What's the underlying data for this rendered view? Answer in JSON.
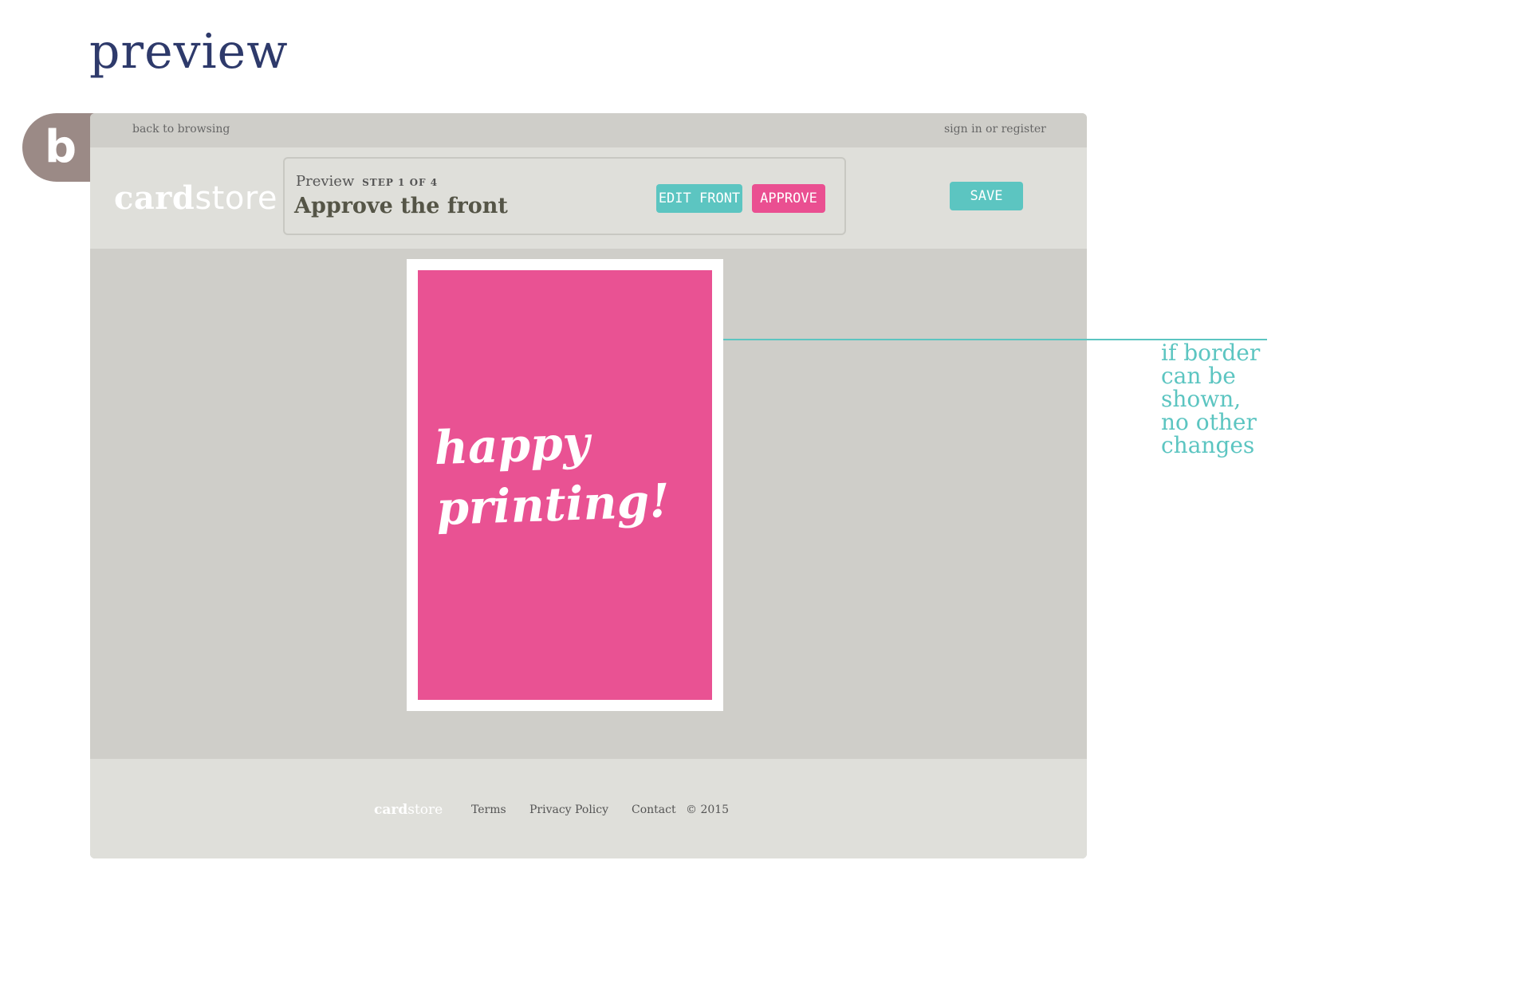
{
  "page": {
    "title": "preview",
    "badge": "b"
  },
  "topbar": {
    "back_label": "back to browsing",
    "signin_label": "sign in or register"
  },
  "header": {
    "logo_bold": "card",
    "logo_light": "store",
    "step_label": "Preview",
    "step_counter": "STEP 1 OF 4",
    "step_title": "Approve the front",
    "edit_front_label": "EDIT FRONT",
    "approve_label": "APPROVE",
    "save_label": "SAVE"
  },
  "card": {
    "line1": "happy",
    "line2": "printing!"
  },
  "footer": {
    "logo_bold": "card",
    "logo_light": "store",
    "terms": "Terms",
    "privacy": "Privacy Policy",
    "contact": "Contact",
    "copyright": "© 2015"
  },
  "annotation": {
    "lines": [
      "if border",
      "can be",
      "shown,",
      "no other",
      "changes"
    ]
  },
  "colors": {
    "teal": "#5cc5c1",
    "pink": "#e95293",
    "title": "#2e3a6b",
    "badge": "#9b8a86"
  }
}
